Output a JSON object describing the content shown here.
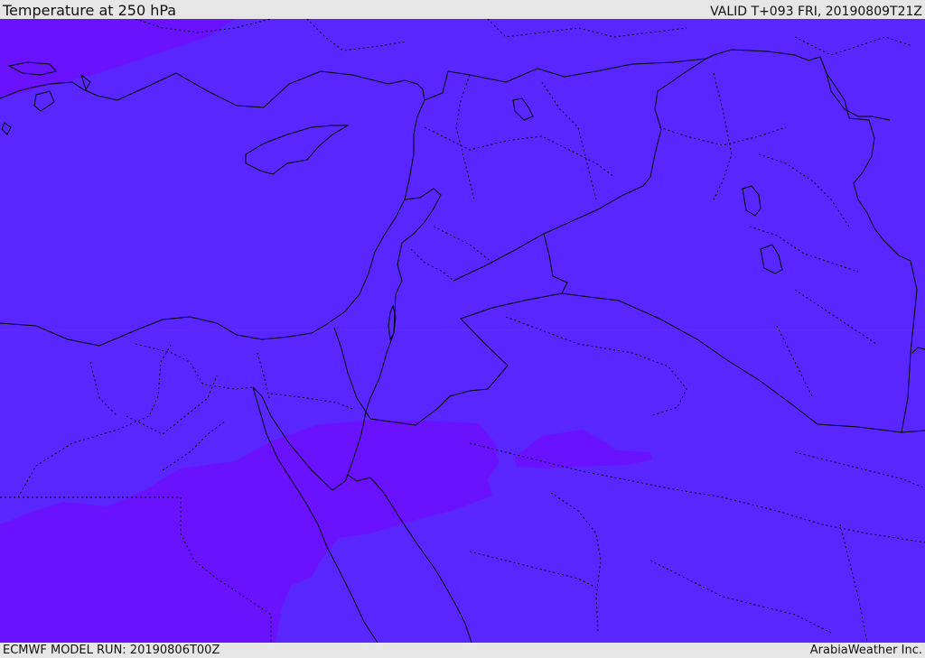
{
  "header": {
    "title": "Temperature at 250 hPa",
    "valid": "VALID T+093 FRI, 20190809T21Z"
  },
  "footer": {
    "model_run": "ECMWF MODEL RUN: 20190806T00Z",
    "credit": "ArabiaWeather Inc."
  },
  "map": {
    "colors": {
      "background_field": "#5a26ff",
      "warmer_field": "#6a12ff",
      "coastline": "#000000",
      "border": "#000000"
    }
  }
}
